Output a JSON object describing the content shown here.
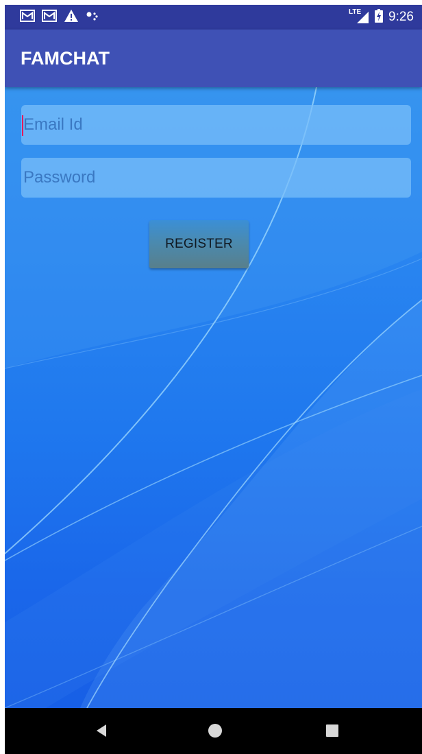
{
  "status_bar": {
    "time": "9:26",
    "network_label": "LTE",
    "icons": [
      "gmail-icon",
      "gmail-icon",
      "warning-icon",
      "assistant-dots-icon",
      "lte-signal-icon",
      "battery-charging-icon"
    ]
  },
  "app_bar": {
    "title": "FAMCHAT"
  },
  "form": {
    "email_placeholder": "Email Id",
    "email_value": "",
    "password_placeholder": "Password",
    "password_value": "",
    "register_label": "REGISTER"
  },
  "nav_bar": {
    "icons": [
      "back-icon",
      "home-icon",
      "recents-icon"
    ]
  },
  "colors": {
    "status_bar": "#2f3a9c",
    "app_bar": "#3f51b5",
    "accent_caret": "#e2195c",
    "wallpaper": "#1f78ee"
  }
}
